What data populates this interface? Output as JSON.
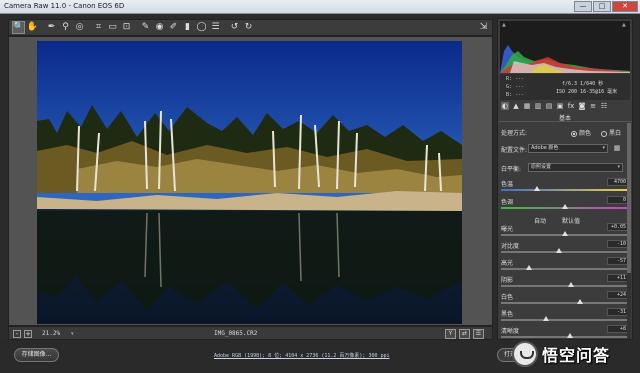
{
  "window": {
    "title": "Camera Raw 11.0 - Canon EOS 6D",
    "minimize": "—",
    "maximize": "□",
    "close": "✕"
  },
  "toolbar": {
    "tools": [
      {
        "name": "zoom-tool-icon",
        "glyph": "🔍",
        "active": true
      },
      {
        "name": "hand-tool-icon",
        "glyph": "✋",
        "active": false
      },
      {
        "name": "white-balance-tool-icon",
        "glyph": "✒",
        "active": false
      },
      {
        "name": "color-sampler-tool-icon",
        "glyph": "⚲",
        "active": false
      },
      {
        "name": "targeted-adjustment-tool-icon",
        "glyph": "◎",
        "active": false
      },
      {
        "name": "crop-tool-icon",
        "glyph": "⌗",
        "active": false
      },
      {
        "name": "straighten-tool-icon",
        "glyph": "▭",
        "active": false
      },
      {
        "name": "transform-tool-icon",
        "glyph": "⊡",
        "active": false
      },
      {
        "name": "spot-removal-tool-icon",
        "glyph": "✎",
        "active": false
      },
      {
        "name": "red-eye-tool-icon",
        "glyph": "◉",
        "active": false
      },
      {
        "name": "adjustment-brush-icon",
        "glyph": "✐",
        "active": false
      },
      {
        "name": "graduated-filter-icon",
        "glyph": "▮",
        "active": false
      },
      {
        "name": "radial-filter-icon",
        "glyph": "◯",
        "active": false
      },
      {
        "name": "preferences-icon",
        "glyph": "☰",
        "active": false
      },
      {
        "name": "rotate-left-icon",
        "glyph": "↺",
        "active": false
      },
      {
        "name": "rotate-right-icon",
        "glyph": "↻",
        "active": false
      }
    ],
    "export_glyph": "⇲"
  },
  "image": {
    "filename": "IMG_0865.CR2",
    "sky_top": "#0a2a8a",
    "sky_bottom": "#2f68c2",
    "water": "#0a1628"
  },
  "status": {
    "zoom_minus": "-",
    "zoom_plus": "+",
    "zoom_value": "21.2%",
    "zoom_arrow": "▾",
    "btn_y": "Y",
    "btn_compare": "⇄",
    "btn_settings": "☰"
  },
  "bottom": {
    "save_label": "存储图像...",
    "workflow_link": "Adobe RGB (1998); 8 位; 4104 x 2736 (11.2 百万像素); 300 ppi",
    "open_label": "打开",
    "watermark_text": "悟空问答"
  },
  "histogram": {
    "clip_shadow": "▲",
    "clip_highlight": "▲"
  },
  "readout": {
    "r": "R:   ---",
    "g": "G:   ---",
    "b": "B:   ---",
    "exif1": "f/6.3   1/640 秒",
    "exif2": "ISO 200   16-35@16 毫米"
  },
  "panel": {
    "tabs": [
      "◐",
      "▲",
      "▦",
      "▥",
      "▤",
      "▣",
      "fx",
      "◙",
      "≡",
      "☷"
    ],
    "title": "基本",
    "treatment_label": "处理方式:",
    "treatment_color": "颜色",
    "treatment_bw": "黑白",
    "profile_label": "配置文件:",
    "profile_value": "Adobe 颜色",
    "wb_label": "白平衡:",
    "wb_value": "原照设置",
    "auto": "自动",
    "default": "默认值",
    "sliders": [
      {
        "key": "temp",
        "label": "色温",
        "value": "4700",
        "pos": 0.28
      },
      {
        "key": "tint",
        "label": "色调",
        "value": "0",
        "pos": 0.5
      },
      {
        "key": "exposure",
        "label": "曝光",
        "value": "+0.05",
        "pos": 0.5
      },
      {
        "key": "contrast",
        "label": "对比度",
        "value": "-10",
        "pos": 0.45
      },
      {
        "key": "highlights",
        "label": "高光",
        "value": "-57",
        "pos": 0.22
      },
      {
        "key": "shadows",
        "label": "阴影",
        "value": "+11",
        "pos": 0.55
      },
      {
        "key": "whites",
        "label": "白色",
        "value": "+24",
        "pos": 0.62
      },
      {
        "key": "blacks",
        "label": "黑色",
        "value": "-31",
        "pos": 0.35
      },
      {
        "key": "clarity",
        "label": "清晰度",
        "value": "+8",
        "pos": 0.54
      }
    ]
  }
}
